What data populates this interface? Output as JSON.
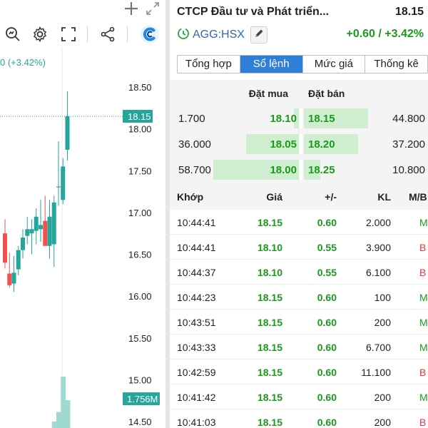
{
  "chart": {
    "change_label": "0 (+3.42%)",
    "last_price_tag": "18.15",
    "volume_tag": "1.756M",
    "y_ticks": [
      "18.50",
      "18.00",
      "17.50",
      "17.00",
      "16.50",
      "16.00",
      "15.50",
      "15.00",
      "14.50"
    ],
    "y_min": 14.5,
    "y_max": 18.5,
    "last_price": 18.15,
    "candles": [
      {
        "o": 16.75,
        "h": 16.92,
        "l": 16.33,
        "c": 16.4
      },
      {
        "o": 16.27,
        "h": 16.52,
        "l": 16.1,
        "c": 16.13
      },
      {
        "o": 16.15,
        "h": 16.48,
        "l": 16.05,
        "c": 16.28
      },
      {
        "o": 16.32,
        "h": 16.6,
        "l": 16.25,
        "c": 16.55
      },
      {
        "o": 16.55,
        "h": 16.8,
        "l": 16.45,
        "c": 16.7
      },
      {
        "o": 16.72,
        "h": 16.95,
        "l": 16.62,
        "c": 16.8
      },
      {
        "o": 16.75,
        "h": 16.92,
        "l": 16.5,
        "c": 16.8
      },
      {
        "o": 16.78,
        "h": 17.05,
        "l": 16.62,
        "c": 16.95
      },
      {
        "o": 16.8,
        "h": 17.15,
        "l": 16.65,
        "c": 16.85
      },
      {
        "o": 16.9,
        "h": 17.2,
        "l": 16.7,
        "c": 16.6
      },
      {
        "o": 16.6,
        "h": 17.15,
        "l": 16.45,
        "c": 16.95
      },
      {
        "o": 16.62,
        "h": 17.2,
        "l": 16.35,
        "c": 17.12
      },
      {
        "o": 17.3,
        "h": 17.85,
        "l": 17.08,
        "c": 17.31
      },
      {
        "o": 17.15,
        "h": 17.65,
        "l": 17.1,
        "c": 17.55
      },
      {
        "o": 17.75,
        "h": 18.45,
        "l": 17.62,
        "c": 18.15
      }
    ],
    "volumes": [
      0,
      0,
      0,
      0,
      0,
      0,
      0,
      0,
      0,
      0,
      0,
      0.22,
      0.55,
      1.756,
      0.95
    ]
  },
  "header": {
    "company": "CTCP Đầu tư và Phát triển...",
    "price": "18.15",
    "ticker": "AGG:HSX",
    "change": "+0.60 / +3.42%"
  },
  "tabs": [
    {
      "label": "Tổng hợp",
      "active": false
    },
    {
      "label": "Sổ lệnh",
      "active": true
    },
    {
      "label": "Mức giá",
      "active": false
    },
    {
      "label": "Thống kê",
      "active": false
    }
  ],
  "order_book": {
    "bid_header": "Đặt mua",
    "ask_header": "Đặt bán",
    "rows": [
      {
        "bid_vol": "1.700",
        "bid_price": "18.10",
        "ask_price": "18.15",
        "ask_vol": "44.800",
        "bid_frac": 0.04,
        "ask_frac": 0.51
      },
      {
        "bid_vol": "36.000",
        "bid_price": "18.05",
        "ask_price": "18.20",
        "ask_vol": "37.200",
        "bid_frac": 0.42,
        "ask_frac": 0.43
      },
      {
        "bid_vol": "58.700",
        "bid_price": "18.00",
        "ask_price": "18.25",
        "ask_vol": "10.800",
        "bid_frac": 0.68,
        "ask_frac": 0.13
      }
    ]
  },
  "trades": {
    "headers": {
      "time": "Khớp",
      "price": "Giá",
      "change": "+/-",
      "volume": "KL",
      "side": "M/B"
    },
    "rows": [
      {
        "time": "10:44:41",
        "price": "18.15",
        "change": "0.60",
        "volume": "2.000",
        "side": "M"
      },
      {
        "time": "10:44:41",
        "price": "18.10",
        "change": "0.55",
        "volume": "3.900",
        "side": "B"
      },
      {
        "time": "10:44:37",
        "price": "18.10",
        "change": "0.55",
        "volume": "6.100",
        "side": "B"
      },
      {
        "time": "10:44:23",
        "price": "18.15",
        "change": "0.60",
        "volume": "100",
        "side": "M"
      },
      {
        "time": "10:43:51",
        "price": "18.15",
        "change": "0.60",
        "volume": "200",
        "side": "M"
      },
      {
        "time": "10:43:33",
        "price": "18.15",
        "change": "0.60",
        "volume": "6.700",
        "side": "M"
      },
      {
        "time": "10:42:59",
        "price": "18.15",
        "change": "0.60",
        "volume": "11.100",
        "side": "B"
      },
      {
        "time": "10:41:42",
        "price": "18.15",
        "change": "0.60",
        "volume": "200",
        "side": "M"
      },
      {
        "time": "10:41:03",
        "price": "18.15",
        "change": "0.60",
        "volume": "200",
        "side": "B"
      }
    ]
  },
  "colors": {
    "up": "#26a69a",
    "down": "#ef5350",
    "price_green": "#1a9a1a",
    "buy_side": "#1a9a1a",
    "sell_side": "#e53935",
    "active_tab": "#2f7fd6",
    "volume_bar": "#9fd9cf",
    "price_tag": "#26a69a"
  },
  "icons": [
    "plus-icon",
    "expand-icon",
    "search-chart-icon",
    "gear-icon",
    "fullscreen-icon",
    "share-icon",
    "app-logo-icon",
    "clock-icon",
    "pencil-icon"
  ]
}
